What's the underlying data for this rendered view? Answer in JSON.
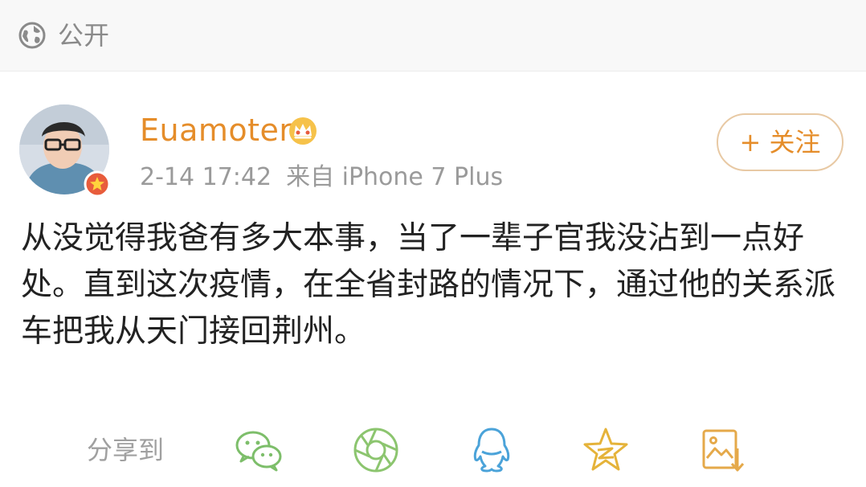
{
  "visibility": {
    "icon": "globe-icon",
    "label": "公开"
  },
  "post": {
    "author": "Euamoter",
    "author_badge_icon": "crown-icon",
    "timestamp": "2-14 17:42",
    "source": "来自 iPhone 7 Plus",
    "follow_label": "+ 关注",
    "text": "从没觉得我爸有多大本事，当了一辈子官我没沾到一点好处。直到这次疫情，在全省封路的情况下，通过他的关系派车把我从天门接回荆州。"
  },
  "share": {
    "label": "分享到",
    "targets": [
      {
        "name": "wechat",
        "icon": "wechat-icon"
      },
      {
        "name": "moments",
        "icon": "moments-icon"
      },
      {
        "name": "qq",
        "icon": "qq-icon"
      },
      {
        "name": "qzone",
        "icon": "qzone-star-icon"
      },
      {
        "name": "save-image",
        "icon": "save-image-icon"
      }
    ]
  },
  "colors": {
    "accent": "#e58d2a",
    "icon_green": "#7dbe6a",
    "icon_blue": "#4ba3d9",
    "icon_gold": "#e5b33a"
  }
}
